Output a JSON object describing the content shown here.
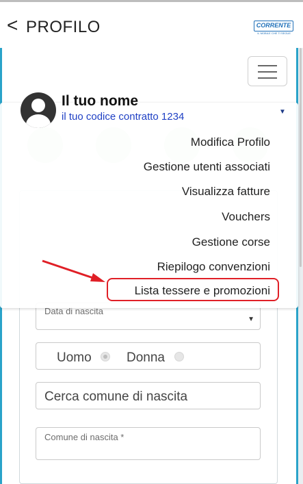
{
  "header": {
    "back_glyph": "<",
    "title": "PROFILO",
    "brand_logo": "CORRENTE",
    "brand_tagline": "IL MOBILE CHE TI SEGUE"
  },
  "menu": {
    "user_name": "Il tuo nome",
    "contract": "il tuo codice contratto 1234",
    "items": [
      {
        "label": "Modifica Profilo"
      },
      {
        "label": "Gestione utenti associati"
      },
      {
        "label": "Visualizza fatture"
      },
      {
        "label": "Vouchers"
      },
      {
        "label": "Gestione corse"
      },
      {
        "label": "Riepilogo convenzioni"
      },
      {
        "label": "Lista tessere e promozioni"
      }
    ],
    "highlight_color": "#e01f26"
  },
  "form": {
    "birth_date_label": "Data di nascita",
    "gender_male": "Uomo",
    "gender_female": "Donna",
    "search_birth_city_placeholder": "Cerca comune di nascita",
    "birth_city_label": "Comune di nascita *"
  },
  "colors": {
    "accent": "#2aa3c9",
    "link_blue": "#1e3fc4"
  }
}
